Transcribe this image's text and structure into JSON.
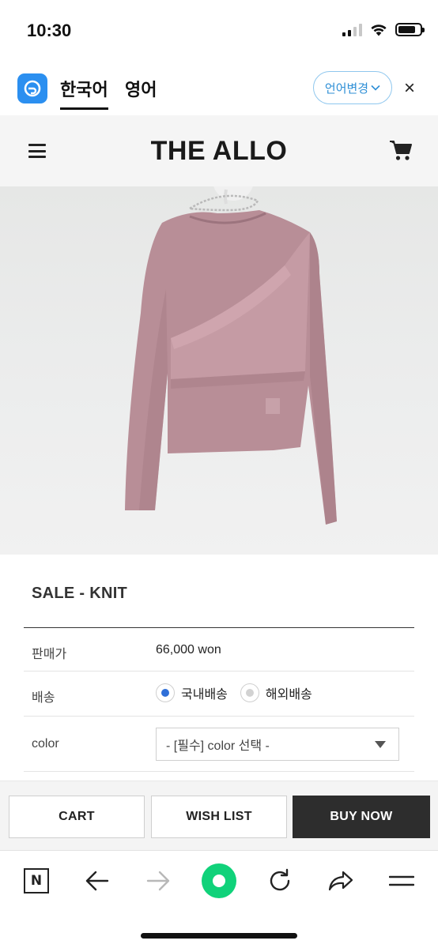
{
  "status_bar": {
    "time": "10:30"
  },
  "translate_bar": {
    "tabs": [
      {
        "label": "한국어",
        "active": true
      },
      {
        "label": "영어",
        "active": false
      }
    ],
    "change_language_label": "언어변경",
    "close_label": "×"
  },
  "site_header": {
    "brand": "THE ALLO",
    "menu_icon": "hamburger-icon",
    "cart_icon": "cart-icon"
  },
  "product": {
    "title": "SALE - KNIT",
    "image_alt_icon": "pink-knit-top-photo",
    "rows": {
      "price": {
        "label": "판매가",
        "value": "66,000 won"
      },
      "shipping": {
        "label": "배송",
        "options": [
          {
            "label": "국내배송",
            "selected": true
          },
          {
            "label": "해외배송",
            "selected": false
          }
        ]
      },
      "color": {
        "label": "color",
        "selected": "- [필수] color 선택 -"
      }
    }
  },
  "actions": {
    "cart": "CART",
    "wish_list": "WISH LIST",
    "buy_now": "BUY NOW"
  },
  "browser_toolbar": {
    "n_label": "N",
    "icons": [
      "naver-n-icon",
      "back-arrow-icon",
      "forward-arrow-icon",
      "home-green-icon",
      "reload-icon",
      "share-icon",
      "menu-lines-icon"
    ]
  },
  "colors": {
    "accent_blue": "#2e8fd6",
    "radio_selected": "#2f6fd8",
    "buy_now_bg": "#2d2d2d",
    "home_green": "#10d27a",
    "knit_pink": "#b88e97"
  }
}
